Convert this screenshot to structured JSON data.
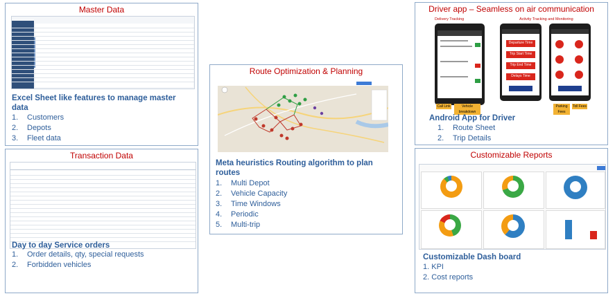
{
  "panels": {
    "master": {
      "title": "Master Data",
      "heading": "Excel Sheet like features to manage master data",
      "items": [
        {
          "n": "1.",
          "t": "Customers"
        },
        {
          "n": "2.",
          "t": "Depots"
        },
        {
          "n": "3.",
          "t": "Fleet data"
        }
      ]
    },
    "transaction": {
      "title": "Transaction Data",
      "heading": "Day to day Service orders",
      "items": [
        {
          "n": "1.",
          "t": "Order details, qty, special requests"
        },
        {
          "n": "2.",
          "t": "Forbidden vehicles"
        }
      ]
    },
    "route": {
      "title": "Route Optimization & Planning",
      "heading": "Meta heuristics Routing algorithm to plan routes",
      "items": [
        {
          "n": "1.",
          "t": "Multi Depot"
        },
        {
          "n": "2.",
          "t": "Vehicle Capacity"
        },
        {
          "n": "3.",
          "t": "Time Windows"
        },
        {
          "n": "4.",
          "t": "Periodic"
        },
        {
          "n": "5.",
          "t": "Multi-trip"
        }
      ]
    },
    "driver": {
      "title": "Driver app – Seamless on air communication",
      "heading": "Android App for Driver",
      "sub1": "Delivery Tracking",
      "sub2": "Activity Tracking and Monitoring",
      "btns": [
        "Departure Time",
        "Trip Start Time",
        "Trip End Time",
        "Delays Time"
      ],
      "tags": [
        "Call Link",
        "Vehicle breakdown",
        "Parking Fees",
        "Toll Fees"
      ],
      "items": [
        {
          "n": "1.",
          "t": "Route Sheet"
        },
        {
          "n": "2.",
          "t": "Trip Details"
        }
      ]
    },
    "reports": {
      "title": "Customizable Reports",
      "heading": "Customizable Dash board",
      "items": [
        {
          "n": "1.",
          "t": "KPI"
        },
        {
          "n": "2.",
          "t": "Cost reports"
        }
      ]
    }
  },
  "colors": {
    "title_red": "#c00000",
    "heading_blue": "#2e5e9a",
    "border": "#8ea9c8",
    "route_red": "#c0392b",
    "route_green": "#2e9e44",
    "donut_green": "#3aa845",
    "donut_orange": "#f39c12",
    "donut_blue": "#2f7fc2"
  }
}
